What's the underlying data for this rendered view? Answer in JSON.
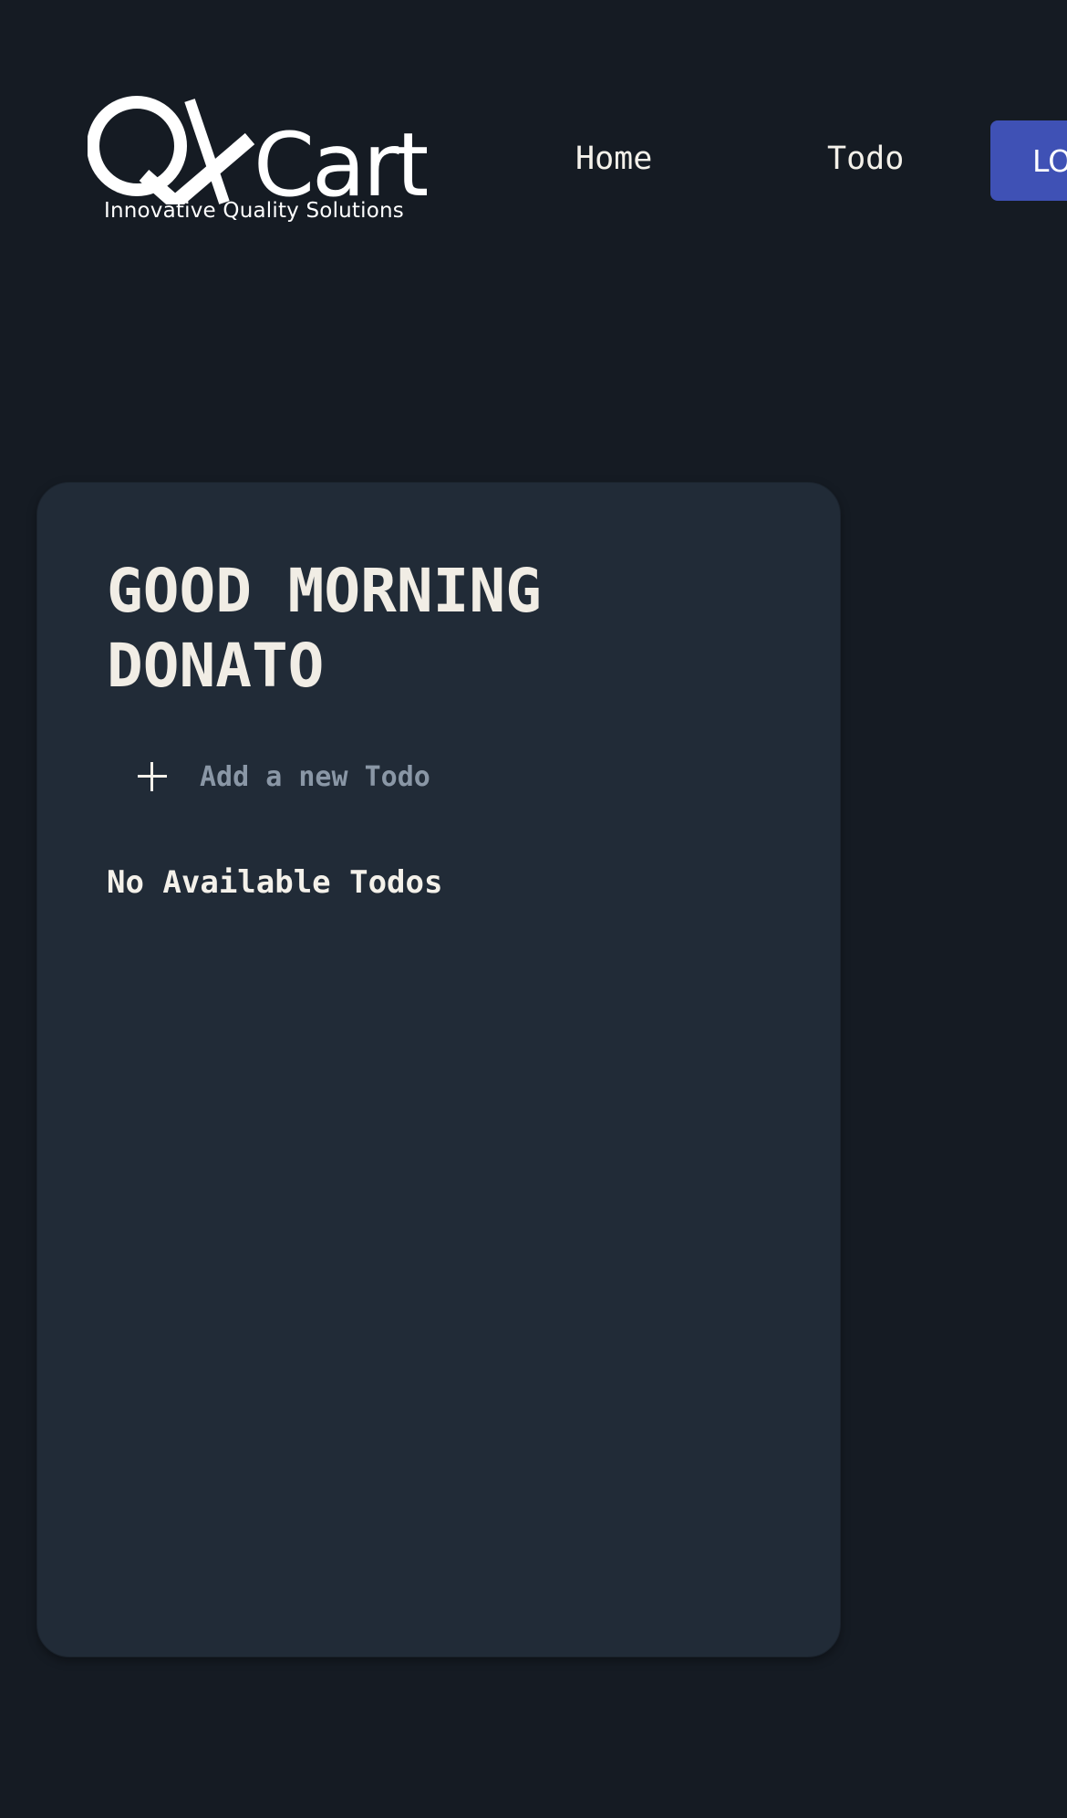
{
  "header": {
    "logo": {
      "wordmark": "QACart",
      "tagline": "Innovative Quality Solutions"
    },
    "nav": {
      "home_label": "Home",
      "todo_label": "Todo"
    },
    "logout_label": "LOGOUT"
  },
  "todo_card": {
    "greeting": "GOOD MORNING DONATO",
    "new_todo_placeholder": "Add a new Todo",
    "empty_message": "No Available Todos"
  },
  "colors": {
    "page_background": "#151b23",
    "card_background": "#212b37",
    "button_background": "#3f51b5",
    "text": "#f4f1ea",
    "placeholder": "#8a97a6"
  },
  "icons": {
    "add": "plus-icon"
  }
}
